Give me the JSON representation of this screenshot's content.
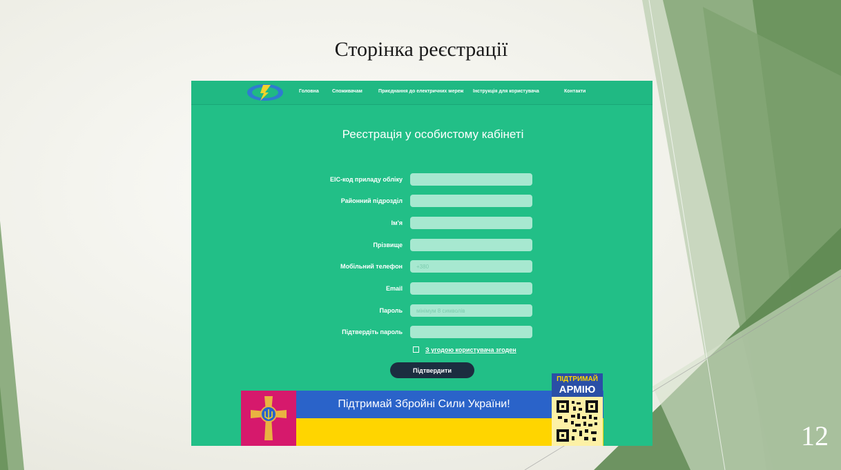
{
  "slide": {
    "title": "Сторінка реєстрації",
    "number": "12"
  },
  "nav": {
    "items": [
      "Головна",
      "Споживачам",
      "Приєднання до електричних мереж",
      "Інструкція для користувача",
      "Контакти"
    ]
  },
  "form": {
    "title": "Реєстрація у особистому кабінеті",
    "fields": [
      {
        "label": "EIC-код приладу обліку",
        "placeholder": ""
      },
      {
        "label": "Районний підрозділ",
        "placeholder": ""
      },
      {
        "label": "Ім'я",
        "placeholder": ""
      },
      {
        "label": "Прізвище",
        "placeholder": ""
      },
      {
        "label": "Мобільний телефон",
        "placeholder": "+380"
      },
      {
        "label": "Email",
        "placeholder": ""
      },
      {
        "label": "Пароль",
        "placeholder": "мінімум 8 символів"
      },
      {
        "label": "Підтвердіть пароль",
        "placeholder": ""
      }
    ],
    "agree_label": "З угодою користувача згоден",
    "submit_label": "Підтвердити"
  },
  "banner": {
    "text": "Підтримай Збройні Сили України!",
    "qr_line1": "ПІДТРИМАЙ",
    "qr_line2": "АРМІЮ"
  },
  "colors": {
    "site_green": "#22bf87",
    "input_bg": "#a7e8d0",
    "button_dark": "#1c2d40",
    "flag_blue": "#2a63c9",
    "flag_yellow": "#ffd500",
    "emblem_crimson": "#d6196c"
  },
  "icons": {
    "logo": "company-logo-icon",
    "emblem": "armed-forces-emblem-icon",
    "qr": "qr-code-icon"
  }
}
